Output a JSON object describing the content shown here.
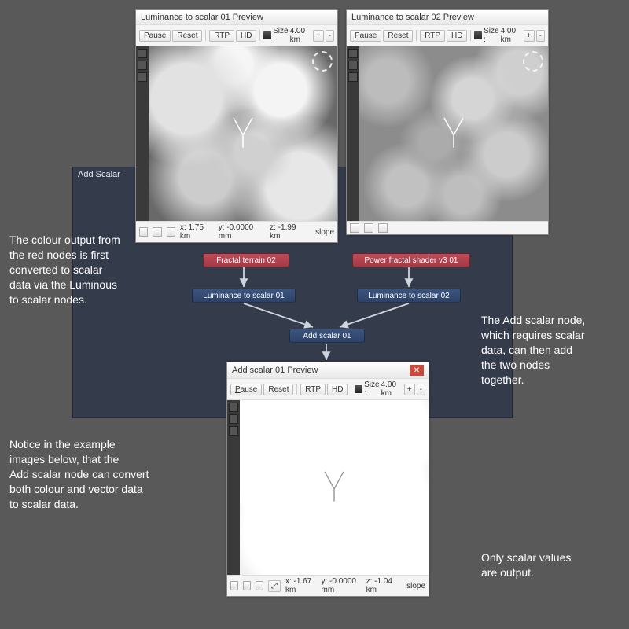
{
  "annotations": {
    "left_top": "The colour output from\nthe red nodes is first\nconverted to scalar\ndata via the Luminous\nto scalar nodes.",
    "left_bottom": "Notice in the example\nimages below, that the\nAdd scalar node can convert\nboth colour and vector data\nto scalar data.",
    "right_mid": "The Add scalar node,\nwhich requires scalar\ndata, can then add\nthe two nodes\ntogether.",
    "right_bottom": "Only scalar values\nare output."
  },
  "node_panel": {
    "title": "Add Scalar"
  },
  "nodes": {
    "fractal": "Fractal terrain 02",
    "power": "Power fractal shader v3 01",
    "lum1": "Luminance to scalar 01",
    "lum2": "Luminance to scalar 02",
    "add": "Add scalar 01"
  },
  "preview_common": {
    "pause": "Pause",
    "reset": "Reset",
    "rtp": "RTP",
    "hd": "HD",
    "size_label": "Size :",
    "size_value": "4.00 km",
    "plus": "+",
    "minus": "-",
    "zoom": "⤢",
    "slope": "slope"
  },
  "preview1": {
    "title": "Luminance to scalar 01 Preview",
    "status_x": "x: 1.75 km",
    "status_y": "y: -0.0000 mm",
    "status_z": "z: -1.99 km"
  },
  "preview2": {
    "title": "Luminance to scalar 02 Preview",
    "status_x": "",
    "status_y": "",
    "status_z": ""
  },
  "preview3": {
    "title": "Add scalar 01 Preview",
    "status_x": "x: -1.67 km",
    "status_y": "y: -0.0000 mm",
    "status_z": "z: -1.04 km"
  }
}
